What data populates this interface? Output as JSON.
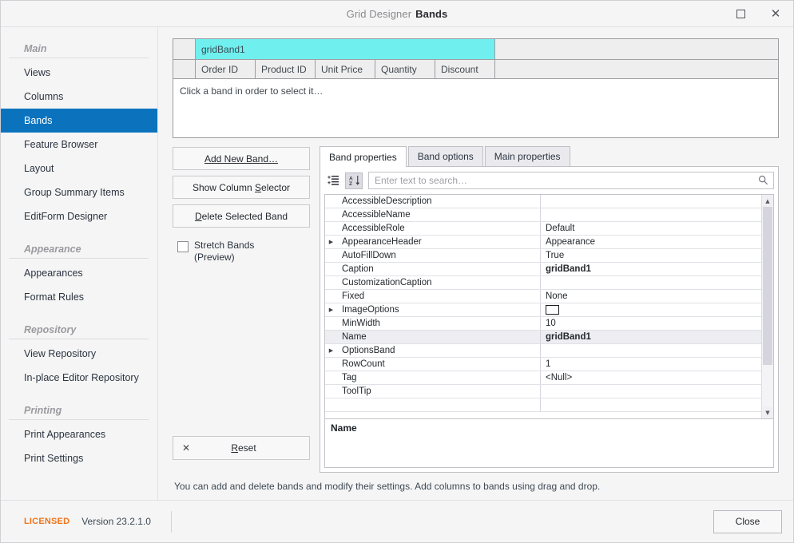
{
  "window": {
    "title_app": "Grid Designer",
    "title_page": "Bands",
    "maximize_label": "maximize-icon",
    "close_label": "✕"
  },
  "sidebar": {
    "groups": [
      {
        "title": "Main",
        "items": [
          {
            "label": "Views",
            "selected": false
          },
          {
            "label": "Columns",
            "selected": false
          },
          {
            "label": "Bands",
            "selected": true
          },
          {
            "label": "Feature Browser",
            "selected": false
          },
          {
            "label": "Layout",
            "selected": false
          },
          {
            "label": "Group Summary Items",
            "selected": false
          },
          {
            "label": "EditForm Designer",
            "selected": false
          }
        ]
      },
      {
        "title": "Appearance",
        "items": [
          {
            "label": "Appearances",
            "selected": false
          },
          {
            "label": "Format Rules",
            "selected": false
          }
        ]
      },
      {
        "title": "Repository",
        "items": [
          {
            "label": "View Repository",
            "selected": false
          },
          {
            "label": "In-place Editor Repository",
            "selected": false
          }
        ]
      },
      {
        "title": "Printing",
        "items": [
          {
            "label": "Print Appearances",
            "selected": false
          },
          {
            "label": "Print Settings",
            "selected": false
          }
        ]
      }
    ]
  },
  "preview": {
    "band_caption": "gridBand1",
    "columns": [
      "Order ID",
      "Product ID",
      "Unit Price",
      "Quantity",
      "Discount"
    ],
    "hint": "Click a band in order to select it…",
    "band_color": "#6ff0ef"
  },
  "actions": {
    "add_new_band": "Add New Band…",
    "show_column_selector": "Show Column Selector",
    "delete_selected_band": "Delete Selected Band",
    "stretch_bands_line1": "Stretch Bands",
    "stretch_bands_line2": "(Preview)",
    "stretch_bands_checked": false,
    "reset": "Reset",
    "reset_icon": "✕"
  },
  "tabs": [
    {
      "label": "Band properties",
      "active": true
    },
    {
      "label": "Band options",
      "active": false
    },
    {
      "label": "Main properties",
      "active": false
    }
  ],
  "search": {
    "value": "",
    "placeholder": "Enter text to search…"
  },
  "property_grid": {
    "rows": [
      {
        "name": "AccessibleDescription",
        "value": "",
        "expandable": false,
        "bold": false,
        "selected": false
      },
      {
        "name": "AccessibleName",
        "value": "",
        "expandable": false,
        "bold": false,
        "selected": false
      },
      {
        "name": "AccessibleRole",
        "value": "Default",
        "expandable": false,
        "bold": false,
        "selected": false
      },
      {
        "name": "AppearanceHeader",
        "value": "Appearance",
        "expandable": true,
        "bold": false,
        "selected": false
      },
      {
        "name": "AutoFillDown",
        "value": "True",
        "expandable": false,
        "bold": false,
        "selected": false
      },
      {
        "name": "Caption",
        "value": "gridBand1",
        "expandable": false,
        "bold": true,
        "selected": false
      },
      {
        "name": "CustomizationCaption",
        "value": "",
        "expandable": false,
        "bold": false,
        "selected": false
      },
      {
        "name": "Fixed",
        "value": "None",
        "expandable": false,
        "bold": false,
        "selected": false
      },
      {
        "name": "ImageOptions",
        "value": "",
        "expandable": true,
        "bold": false,
        "selected": false,
        "swatch": true
      },
      {
        "name": "MinWidth",
        "value": "10",
        "expandable": false,
        "bold": false,
        "selected": false
      },
      {
        "name": "Name",
        "value": "gridBand1",
        "expandable": false,
        "bold": true,
        "selected": true
      },
      {
        "name": "OptionsBand",
        "value": "",
        "expandable": true,
        "bold": false,
        "selected": false
      },
      {
        "name": "RowCount",
        "value": "1",
        "expandable": false,
        "bold": false,
        "selected": false
      },
      {
        "name": "Tag",
        "value": "<Null>",
        "expandable": false,
        "bold": false,
        "selected": false
      },
      {
        "name": "ToolTip",
        "value": "",
        "expandable": false,
        "bold": false,
        "selected": false
      }
    ],
    "description_title": "Name",
    "description_text": ""
  },
  "status": {
    "text": "You can add and delete bands and modify their settings. Add columns to bands using drag and drop."
  },
  "footer": {
    "license": "LICENSED",
    "version": "Version 23.2.1.0",
    "close": "Close"
  }
}
